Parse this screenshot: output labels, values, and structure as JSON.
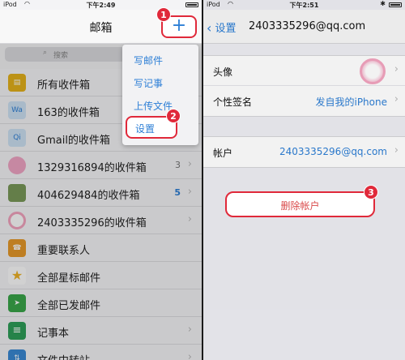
{
  "left": {
    "status": {
      "carrier": "iPod",
      "time": "下午2:49"
    },
    "nav": {
      "title": "邮箱",
      "plus_label": "+"
    },
    "search": {
      "placeholder": "搜索"
    },
    "rows": [
      {
        "label": "所有收件箱",
        "icon": "all-inbox-icon",
        "icon_text": "",
        "color": "#e6b21c",
        "count": ""
      },
      {
        "label": "163的收件箱",
        "icon": "163-mail-icon",
        "icon_text": "Wa",
        "color": "#cfe3f6",
        "count": ""
      },
      {
        "label": "Gmail的收件箱",
        "icon": "gmail-icon",
        "icon_text": "Qi",
        "color": "#cfe3f6",
        "count": ""
      },
      {
        "label": "1329316894的收件箱",
        "icon": "avatar-icon",
        "icon_text": "",
        "color": "#f2a7c6",
        "count": "3"
      },
      {
        "label": "404629484的收件箱",
        "icon": "avatar-icon",
        "icon_text": "",
        "color": "#7a9a5a",
        "count": "5"
      },
      {
        "label": "2403335296的收件箱",
        "icon": "avatar-icon",
        "icon_text": "",
        "color": "#f4a5c0",
        "count": ""
      },
      {
        "label": "重要联系人",
        "icon": "contacts-icon",
        "icon_text": "",
        "color": "#e89a2a",
        "count": ""
      },
      {
        "label": "全部星标邮件",
        "icon": "star-icon",
        "icon_text": "★",
        "color": "#f0b326",
        "count": ""
      },
      {
        "label": "全部已发邮件",
        "icon": "sent-icon",
        "icon_text": "➤",
        "color": "#3aa84a",
        "count": ""
      },
      {
        "label": "记事本",
        "icon": "notes-icon",
        "icon_text": "≡",
        "color": "#2fa05a",
        "count": ""
      },
      {
        "label": "文件中转站",
        "icon": "file-transfer-icon",
        "icon_text": "",
        "color": "#3a8ad6",
        "count": ""
      }
    ],
    "menu": [
      "写邮件",
      "写记事",
      "上传文件",
      "设置"
    ],
    "badges": {
      "one": "1",
      "two": "2"
    }
  },
  "right": {
    "status": {
      "carrier": "iPod",
      "time": "下午2:51"
    },
    "back_label": "设置",
    "title": "2403335296@qq.com",
    "avatar_label": "头像",
    "signature_label": "个性签名",
    "signature_value": "发自我的iPhone",
    "account_label": "帐户",
    "account_value": "2403335296@qq.com",
    "delete_label": "删除帐户",
    "badge_three": "3"
  },
  "colors": {
    "accent": "#2d7fd6",
    "highlight": "#e0293a"
  }
}
